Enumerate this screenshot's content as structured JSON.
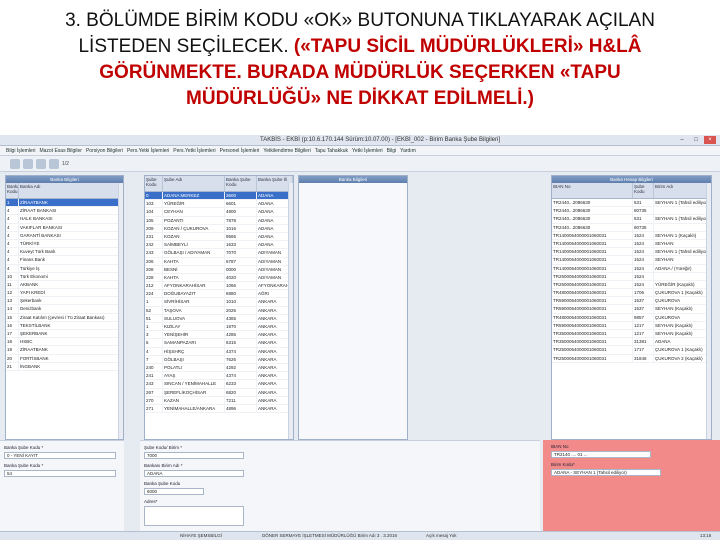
{
  "caption": {
    "line1": "3. BÖLÜMDE BİRİM KODU «OK» BUTONUNA TIKLAYARAK AÇILAN",
    "line2_normal": "LİSTEDEN SEÇİLECEK. ",
    "line2_red": "(«TAPU SİCİL MÜDÜRLÜKLERİ» H&LÂ",
    "line3": "GÖRÜNMEKTE. BURADA MÜDÜRLÜK SEÇERKEN «TAPU",
    "line4": "MÜDÜRLÜĞÜ» NE DİKKAT EDİLMELİ.)"
  },
  "window": {
    "title": "TAKBİS - EKBİ (p:10.6.170.144 Sürüm:10.07.00) - [EKBİ_002 - Birim Banka Şube Bilgileri]"
  },
  "menu": [
    "Bilgi İşlemleri",
    "Mazot Esas Bilgiler",
    "Porsiyon Bilgileri",
    "Pers.Yetki İşlemleri",
    "Pers.Yetki İşlemleri",
    "Personel İşlemleri",
    "Yetkilendirme Bilgileri",
    "Tapu Tahakkuk",
    "Yetki İşlemleri",
    "Bilgi",
    "Yardım"
  ],
  "toolbar": {
    "count": "1/2"
  },
  "bank_panel": {
    "title": "Banka Bilgileri",
    "headers": [
      "Banka Kodu",
      "Banka Adı"
    ],
    "rows": [
      [
        "1",
        "ZİRAATBANK"
      ],
      [
        "4",
        "ZİRAAT BANKASI"
      ],
      [
        "4",
        "HALK BANKASI"
      ],
      [
        "4",
        "VAKIFLAR BANKASI"
      ],
      [
        "4",
        "GARANTİ BANKASI"
      ],
      [
        "4",
        "TÜRKİYE"
      ],
      [
        "4",
        "Kuveyt Türk Bank"
      ],
      [
        "4",
        "Finans Bank"
      ],
      [
        "4",
        "Türkiye İş"
      ],
      [
        "10",
        "Türk Ekonomi"
      ],
      [
        "11",
        "AKBANK"
      ],
      [
        "12",
        "YAPI KREDİ"
      ],
      [
        "13",
        "Şekerbank"
      ],
      [
        "14",
        "Denizbank"
      ],
      [
        "15",
        "Ziraat Katılım (çevresi / Tü Ziraat Bankası)"
      ],
      [
        "16",
        "TEKSTİLBANK"
      ],
      [
        "17",
        "ŞEKERBANK"
      ],
      [
        "18",
        "HSBC"
      ],
      [
        "19",
        "ZİRAATBANK"
      ],
      [
        "20",
        "FORTİSBANK"
      ],
      [
        "21",
        "İNGBANK"
      ]
    ]
  },
  "unit_panel": {
    "headers": [
      "Şube Kodu",
      "Şube Adı",
      "Banka Şube Kodu",
      "Banka Şube İli"
    ],
    "rows": [
      [
        "0",
        "ADANA MERKEZ",
        "3600",
        "ADANA"
      ],
      [
        "103",
        "YÜREĞİR",
        "6601",
        "ADANA"
      ],
      [
        "104",
        "CEYHAN",
        "4800",
        "ADANA"
      ],
      [
        "105",
        "POZANTI",
        "7878",
        "ADANA"
      ],
      [
        "209",
        "KOZAN / ÇUKUROVA",
        "1016",
        "ADANA"
      ],
      [
        "231",
        "KOZAN",
        "9565",
        "ADANA"
      ],
      [
        "242",
        "SAİMBEYLİ",
        "1633",
        "ADANA"
      ],
      [
        "243",
        "GÖLBAŞI / ADIYAMAN",
        "7070",
        "ADIYAMAN"
      ],
      [
        "206",
        "KAHTA",
        "6787",
        "ADIYAMAN"
      ],
      [
        "208",
        "BESNİ",
        "0000",
        "ADIYAMAN"
      ],
      [
        "228",
        "KAHTA",
        "4020",
        "ADIYAMAN"
      ],
      [
        "212",
        "AFYONKARAHİSAR",
        "1066",
        "AFYONKARAHİSAR"
      ],
      [
        "224",
        "DOĞUBAYAZIT",
        "6880",
        "AĞRI"
      ],
      [
        "1",
        "SİVRİHİSAR",
        "1010",
        "ANKARA"
      ],
      [
        "52",
        "TAŞOVA",
        "2026",
        "ANKARA"
      ],
      [
        "51",
        "SULUOVA",
        "4365",
        "ANKARA"
      ],
      [
        "1",
        "KIZILAY",
        "1970",
        "ANKARA"
      ],
      [
        "3",
        "YENİŞEHİR",
        "4286",
        "ANKARA"
      ],
      [
        "6",
        "SAMANPAZARI",
        "6315",
        "ANKARA"
      ],
      [
        "4",
        "HİŞSHRÇ",
        "4374",
        "ANKARA"
      ],
      [
        "7",
        "GÖLBAŞI",
        "7626",
        "ANKARA"
      ],
      [
        "240",
        "POLATLI",
        "4292",
        "ANKARA"
      ],
      [
        "241",
        "AYAŞ",
        "4374",
        "ANKARA"
      ],
      [
        "243",
        "SINCAN / YENİMAHALLE",
        "6233",
        "ANKARA"
      ],
      [
        "267",
        "ŞEREFLİKOÇHİSAR",
        "6820",
        "ANKARA"
      ],
      [
        "270",
        "KAZAN",
        "7211",
        "ANKARA"
      ],
      [
        "271",
        "YENİMAHALLE/ANKARA",
        "4896",
        "ANKARA"
      ]
    ]
  },
  "mid_panel": {
    "title": "Banka Bilgileri"
  },
  "account_panel": {
    "title": "Banka Hesap Bilgileri",
    "headers": [
      "IBAN No",
      "Şube Kodu",
      "Birim Adı"
    ],
    "rows": [
      [
        "TR2440...2086630",
        "531",
        "SEYHAN 1 (Tahsil ediliyor)"
      ],
      [
        "TR2440...2086630",
        "80735",
        ""
      ],
      [
        "TR2440...2086630",
        "531",
        "SEYHAN 1 (Tahsil ediliyor)"
      ],
      [
        "TR2440...2086630",
        "80735",
        ""
      ],
      [
        "TR1400064000001060031",
        "1524",
        "SEYHAN 1 (Kaçaklı)"
      ],
      [
        "TR1400064000001060031",
        "1524",
        "SEYHAN"
      ],
      [
        "TR1400064000001060031",
        "1524",
        "SEYHAN 1 (Tahsil ediliyor)"
      ],
      [
        "TR1400064000001060031",
        "1524",
        "SEYHAN"
      ],
      [
        "TR1400064000001060031",
        "1524",
        "ADANA / (Yüreğir)"
      ],
      [
        "TR2500064000001060031",
        "1524",
        ""
      ],
      [
        "TR2500064000001060031",
        "1524",
        "YÜREĞİR (Kaçaklı)"
      ],
      [
        "TR4800064000001060031",
        "1706",
        "ÇUKUROVA 1 (Kaçaklı)"
      ],
      [
        "TR5900064000001060031",
        "1537",
        "ÇUKUROVA"
      ],
      [
        "TR5900064000001060031",
        "1537",
        "SEYHAN (Kaçaklı)"
      ],
      [
        "TR4800064000001060031",
        "9857",
        "ÇUKUROVA"
      ],
      [
        "TR5900064000001060031",
        "1217",
        "SEYHAN (Kaçaklı)"
      ],
      [
        "TR3500064000001060031",
        "1217",
        "SEYHAN (Kaçaklı)"
      ],
      [
        "TR3500064000001060031",
        "31381",
        "ADANA"
      ],
      [
        "TR2500064000001060031",
        "1717",
        "ÇUKUROVA 1 (Kaçaklı)"
      ],
      [
        "TR2500064000001060031",
        "31846",
        "ÇUKUROVA 2 (Kaçaklı)"
      ]
    ]
  },
  "form_left": {
    "label1": "Banka Şube Kodu *",
    "value1": "0 - YENİ KAYIT",
    "label2": "Banka Şube Kodu *",
    "value2": "54"
  },
  "form_mid": {
    "label1": "Şube Kodu/ Birim *",
    "value1": "7000",
    "label2": "Bankası Birim Adı *",
    "value2": "ADANA",
    "label3": "Banka Şube Kodu",
    "value3": "6000",
    "label4": "Adres*"
  },
  "form_right": {
    "label1": "IBAN No",
    "value1": "TR2140 .... 01 ...",
    "label2": "Birim Kodu*",
    "value2": "ADANA - SEYHAN 1 (Tahsil ediliyor)"
  },
  "taskbar": {
    "left": "NİHAYE ŞEMSBİLGİ",
    "mid": "DÖNER SERMAYE İŞLETMESİ MÜDÜRLÜĞÜ Birim Adı 3 . 3.2016",
    "right": "Açık mesaj Yok",
    "clock": "13:16"
  }
}
